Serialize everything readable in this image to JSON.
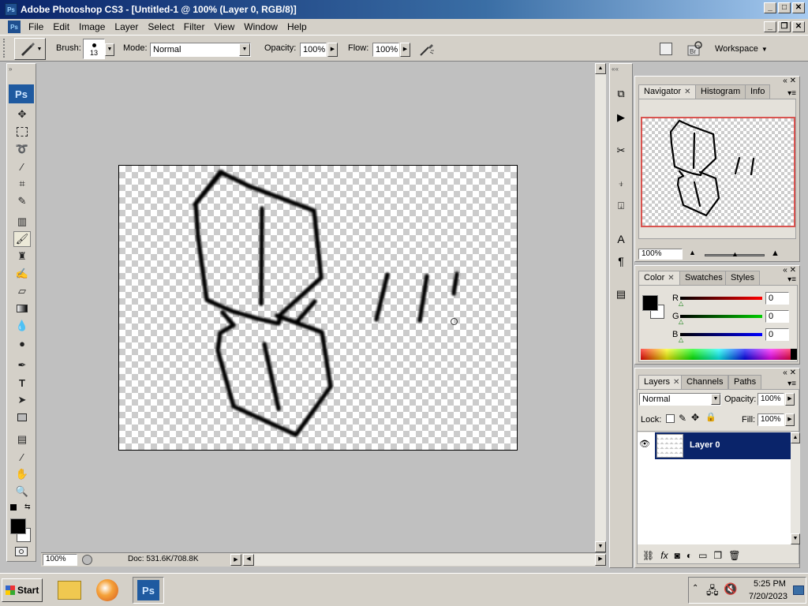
{
  "window": {
    "title": "Adobe Photoshop CS3 - [Untitled-1 @ 100% (Layer 0, RGB/8)]",
    "app_icon": "Ps"
  },
  "menu": [
    "File",
    "Edit",
    "Image",
    "Layer",
    "Select",
    "Filter",
    "View",
    "Window",
    "Help"
  ],
  "options": {
    "brush_label": "Brush:",
    "brush_size": "13",
    "mode_label": "Mode:",
    "mode_value": "Normal",
    "opacity_label": "Opacity:",
    "opacity_value": "100%",
    "flow_label": "Flow:",
    "flow_value": "100%",
    "workspace_label": "Workspace"
  },
  "toolbox": {
    "logo": "Ps"
  },
  "status": {
    "zoom": "100%",
    "doc": "Doc: 531.6K/708.8K"
  },
  "navigator": {
    "tabs": [
      "Navigator",
      "Histogram",
      "Info"
    ],
    "zoom": "100%"
  },
  "color": {
    "tabs": [
      "Color",
      "Swatches",
      "Styles"
    ],
    "channels": [
      {
        "label": "R",
        "value": "0"
      },
      {
        "label": "G",
        "value": "0"
      },
      {
        "label": "B",
        "value": "0"
      }
    ]
  },
  "layers": {
    "tabs": [
      "Layers",
      "Channels",
      "Paths"
    ],
    "blend_mode": "Normal",
    "opacity_label": "Opacity:",
    "opacity_value": "100%",
    "lock_label": "Lock:",
    "fill_label": "Fill:",
    "fill_value": "100%",
    "items": [
      {
        "name": "Layer 0",
        "selected": true
      }
    ]
  },
  "taskbar": {
    "start": "Start",
    "time": "5:25 PM",
    "date": "7/20/2023"
  }
}
